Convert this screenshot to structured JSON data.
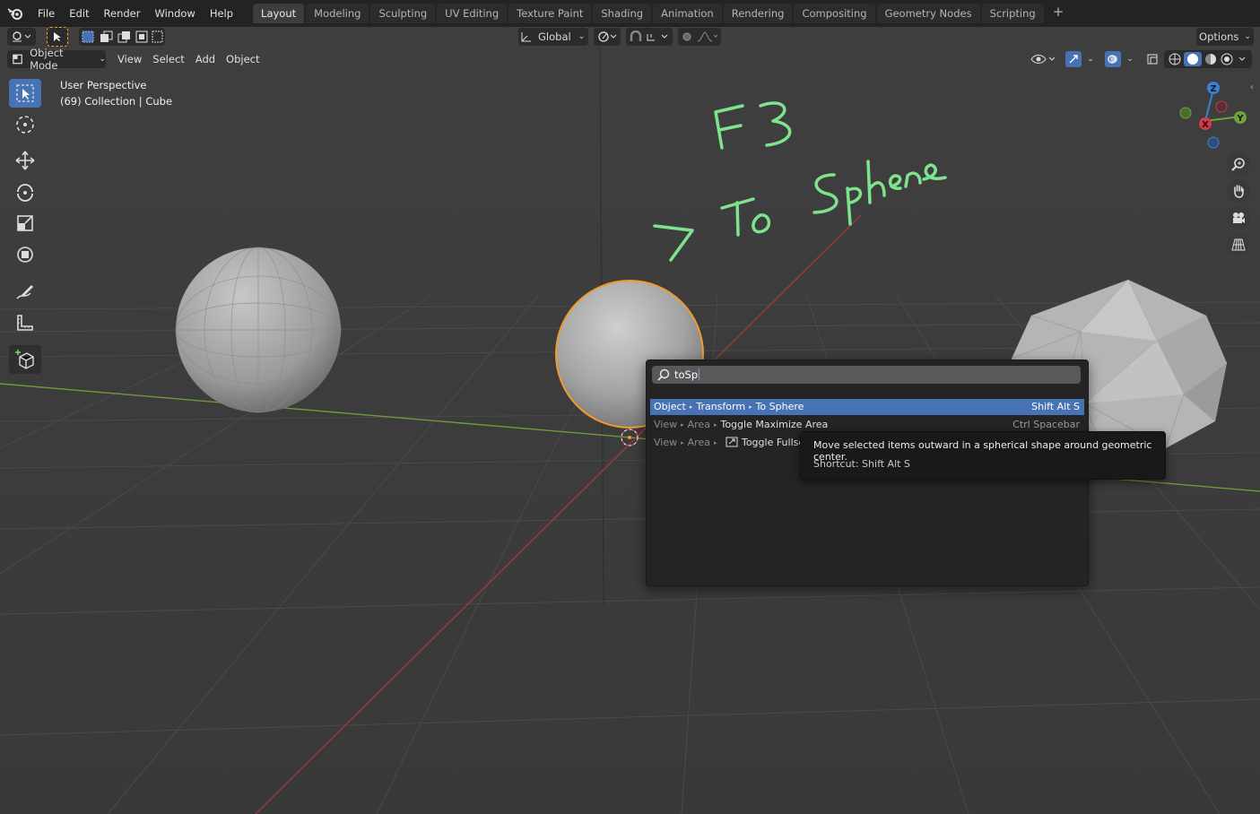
{
  "menu": [
    "File",
    "Edit",
    "Render",
    "Window",
    "Help"
  ],
  "workspaces": [
    "Layout",
    "Modeling",
    "Sculpting",
    "UV Editing",
    "Texture Paint",
    "Shading",
    "Animation",
    "Rendering",
    "Compositing",
    "Geometry Nodes",
    "Scripting"
  ],
  "active_workspace": "Layout",
  "toolbar": {
    "orientation": "Global",
    "options_label": "Options"
  },
  "viewport_header": {
    "mode": "Object Mode",
    "menus": [
      "View",
      "Select",
      "Add",
      "Object"
    ]
  },
  "viewport": {
    "perspective": "User Perspective",
    "context": "(69) Collection | Cube"
  },
  "gizmo": {
    "z": "Z",
    "y": "Y",
    "x": "X"
  },
  "annotation": {
    "line1": "F3",
    "line2": "> To Sphere"
  },
  "search": {
    "query": "toSp",
    "results": [
      {
        "path": [
          "Object",
          "Transform"
        ],
        "name": "To Sphere",
        "shortcut": "Shift Alt S",
        "selected": true
      },
      {
        "path": [
          "View",
          "Area"
        ],
        "name": "Toggle Maximize Area",
        "shortcut": "Ctrl Spacebar",
        "selected": false
      },
      {
        "path": [
          "View",
          "Area"
        ],
        "name": "Toggle Fullscr",
        "shortcut": "",
        "selected": false
      }
    ],
    "tooltip": {
      "description": "Move selected items outward in a spherical shape around geometric center.",
      "shortcut": "Shortcut: Shift Alt S"
    }
  },
  "colors": {
    "accent": "#4772b3",
    "selection_outline": "#f29a2e",
    "annotation": "#7de38f",
    "x_axis": "#9c3a3a",
    "y_axis": "#6f9a3a"
  }
}
